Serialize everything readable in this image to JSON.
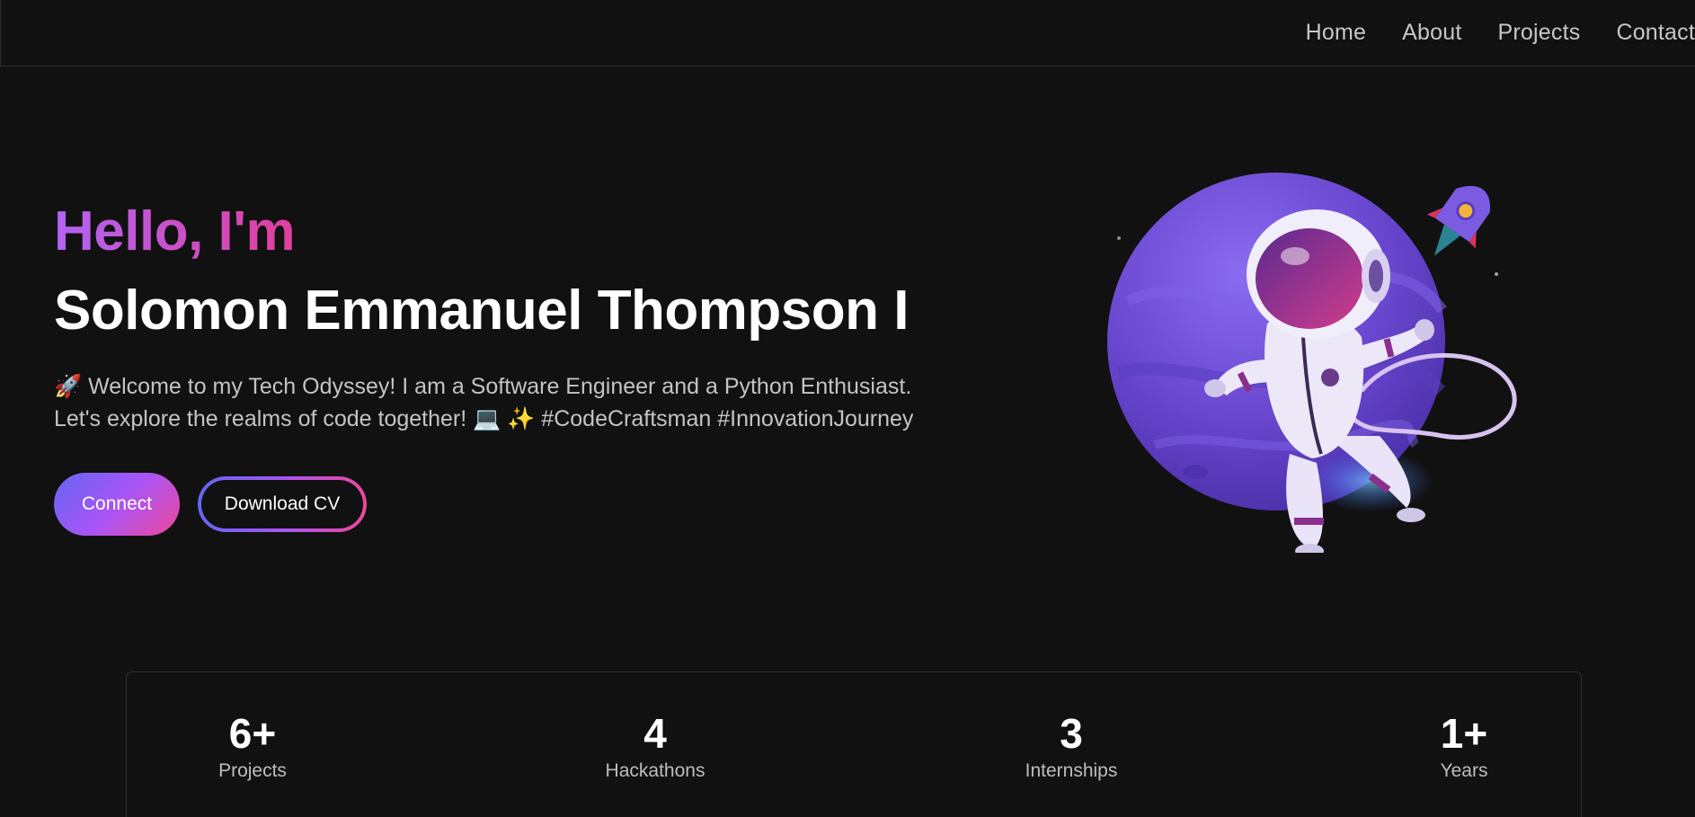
{
  "nav": {
    "items": [
      {
        "label": "Home"
      },
      {
        "label": "About"
      },
      {
        "label": "Projects"
      },
      {
        "label": "Contact"
      }
    ]
  },
  "hero": {
    "greeting": "Hello, I'm",
    "name": "Solomon Emmanuel Thompson I",
    "bio_line1": "🚀 Welcome to my Tech Odyssey! I am a Software Engineer and a Python Enthusiast.",
    "bio_line2": "Let's explore the realms of code together! 💻 ✨ #CodeCraftsman #InnovationJourney",
    "connect_label": "Connect",
    "cv_label": "Download CV"
  },
  "stats": [
    {
      "number": "6+",
      "label": "Projects"
    },
    {
      "number": "4",
      "label": "Hackathons"
    },
    {
      "number": "3",
      "label": "Internships"
    },
    {
      "number": "1+",
      "label": "Years"
    }
  ],
  "colors": {
    "background": "#111111",
    "gradient_start": "#b263f4",
    "gradient_end": "#e03f9c",
    "planet": "#6b4fd1"
  },
  "illustration": {
    "icon": "astronaut-planet-rocket-illustration"
  }
}
